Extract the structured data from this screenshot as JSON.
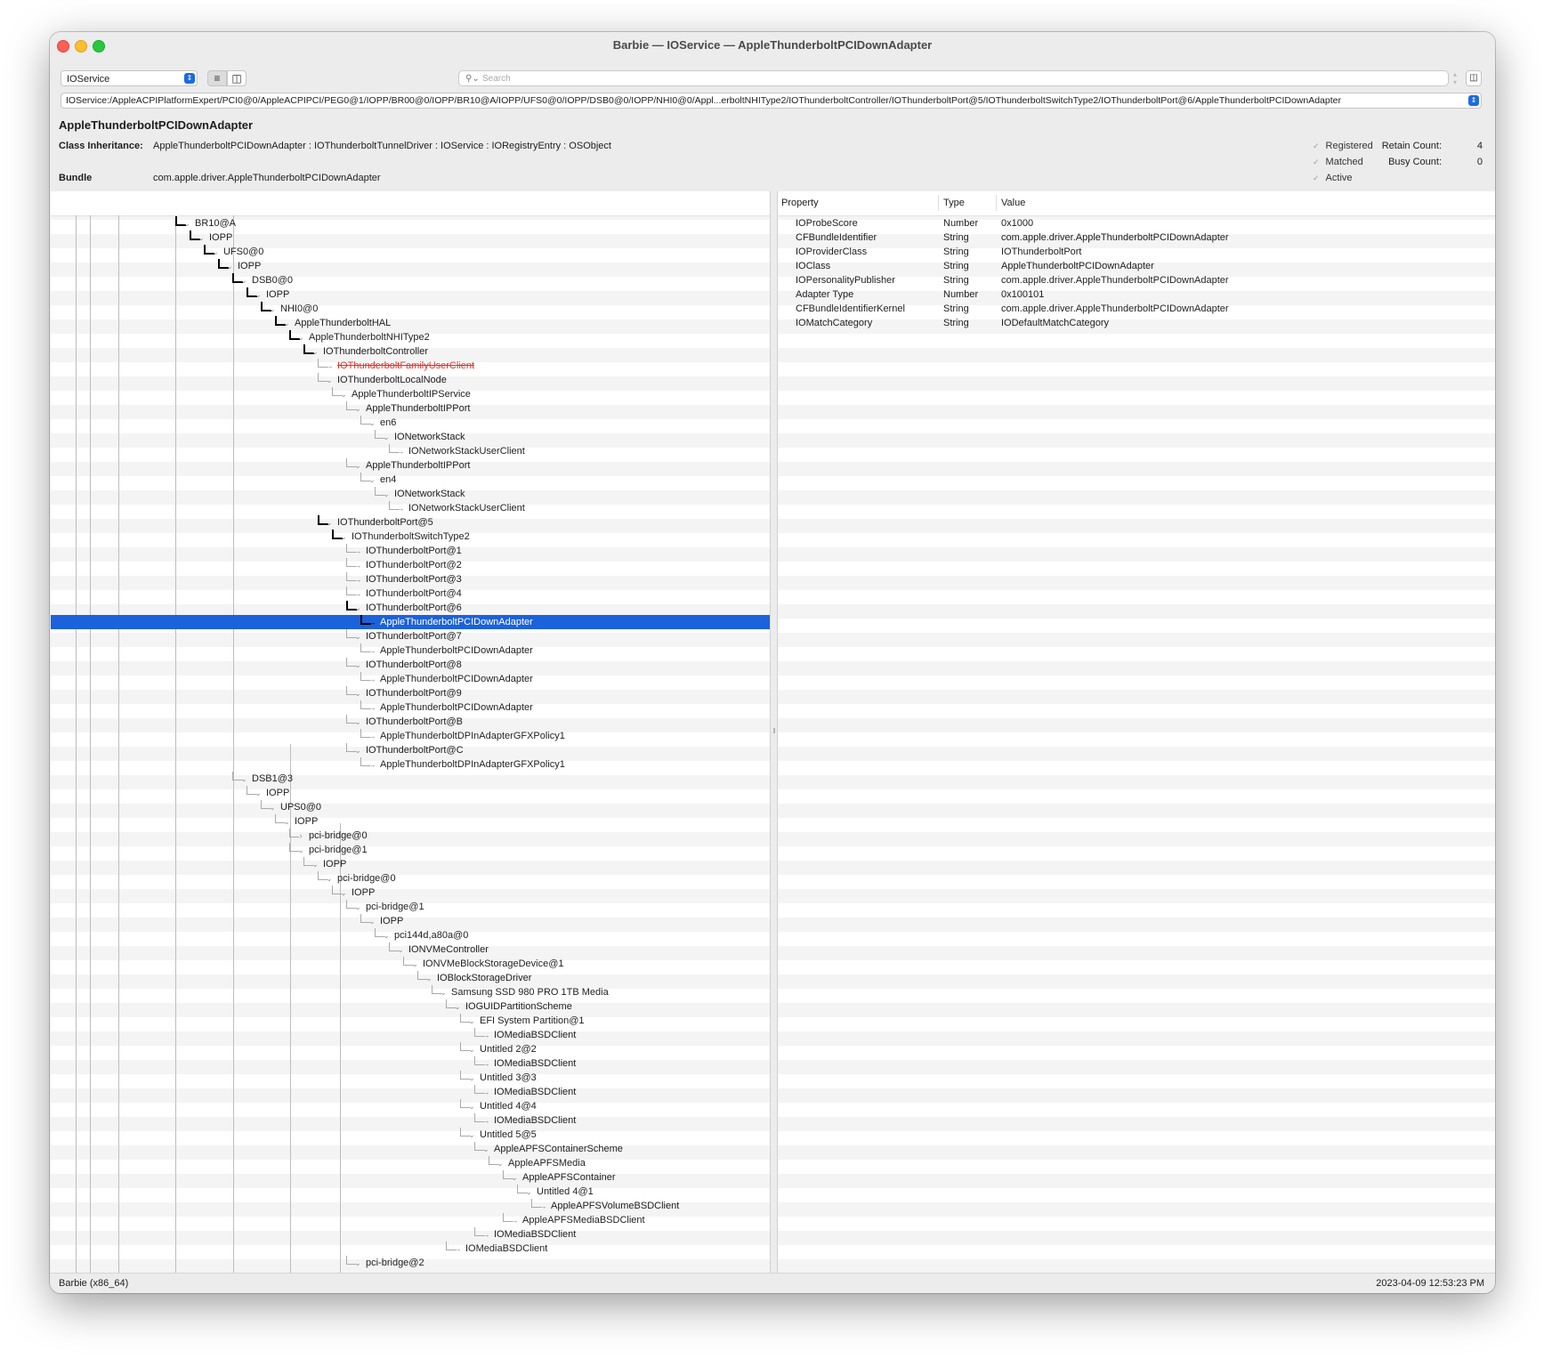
{
  "window": {
    "title": "Barbie — IOService — AppleThunderboltPCIDownAdapter"
  },
  "toolbar": {
    "plane": "IOService",
    "search_placeholder": "Search",
    "path": "IOService:/AppleACPIPlatformExpert/PCI0@0/AppleACPIPCI/PEG0@1/IOPP/BR00@0/IOPP/BR10@A/IOPP/UFS0@0/IOPP/DSB0@0/IOPP/NHI0@0/Appl...erboltNHIType2/IOThunderboltController/IOThunderboltPort@5/IOThunderboltSwitchType2/IOThunderboltPort@6/AppleThunderboltPCIDownAdapter"
  },
  "info": {
    "name": "AppleThunderboltPCIDownAdapter",
    "class_label": "Class Inheritance:",
    "class_value": "AppleThunderboltPCIDownAdapter : IOThunderboltTunnelDriver : IOService : IORegistryEntry : OSObject",
    "bundle_label": "Bundle",
    "bundle_value": "com.apple.driver.AppleThunderboltPCIDownAdapter",
    "flags": [
      "Registered",
      "Matched",
      "Active"
    ],
    "retain_label": "Retain Count:",
    "retain_value": "4",
    "busy_label": "Busy Count:",
    "busy_value": "0"
  },
  "tree": [
    {
      "name": "BR10@A",
      "depth": 0,
      "toggle": "v",
      "dark": true
    },
    {
      "name": "IOPP",
      "depth": 1,
      "toggle": "v",
      "dark": true
    },
    {
      "name": "UFS0@0",
      "depth": 2,
      "toggle": "v",
      "dark": true
    },
    {
      "name": "IOPP",
      "depth": 3,
      "toggle": "v",
      "dark": true
    },
    {
      "name": "DSB0@0",
      "depth": 4,
      "toggle": "v",
      "dark": true
    },
    {
      "name": "IOPP",
      "depth": 5,
      "toggle": "v",
      "dark": true
    },
    {
      "name": "NHI0@0",
      "depth": 6,
      "toggle": "v",
      "dark": true
    },
    {
      "name": "AppleThunderboltHAL",
      "depth": 7,
      "toggle": "v",
      "dark": true
    },
    {
      "name": "AppleThunderboltNHIType2",
      "depth": 8,
      "toggle": "v",
      "dark": true
    },
    {
      "name": "IOThunderboltController",
      "depth": 9,
      "toggle": "v",
      "dark": true
    },
    {
      "name": "IOThunderboltFamilyUserClient",
      "depth": 10,
      "toggle": "-",
      "terminated": true
    },
    {
      "name": "IOThunderboltLocalNode",
      "depth": 10,
      "toggle": "v"
    },
    {
      "name": "AppleThunderboltIPService",
      "depth": 11,
      "toggle": "v"
    },
    {
      "name": "AppleThunderboltIPPort",
      "depth": 12,
      "toggle": "v"
    },
    {
      "name": "en6",
      "depth": 13,
      "toggle": "v"
    },
    {
      "name": "IONetworkStack",
      "depth": 14,
      "toggle": "v"
    },
    {
      "name": "IONetworkStackUserClient",
      "depth": 15,
      "toggle": "-"
    },
    {
      "name": "AppleThunderboltIPPort",
      "depth": 12,
      "toggle": "v"
    },
    {
      "name": "en4",
      "depth": 13,
      "toggle": "v"
    },
    {
      "name": "IONetworkStack",
      "depth": 14,
      "toggle": "v"
    },
    {
      "name": "IONetworkStackUserClient",
      "depth": 15,
      "toggle": "-"
    },
    {
      "name": "IOThunderboltPort@5",
      "depth": 10,
      "toggle": "v",
      "dark": true
    },
    {
      "name": "IOThunderboltSwitchType2",
      "depth": 11,
      "toggle": "v",
      "dark": true
    },
    {
      "name": "IOThunderboltPort@1",
      "depth": 12,
      "toggle": "-"
    },
    {
      "name": "IOThunderboltPort@2",
      "depth": 12,
      "toggle": "-"
    },
    {
      "name": "IOThunderboltPort@3",
      "depth": 12,
      "toggle": "-"
    },
    {
      "name": "IOThunderboltPort@4",
      "depth": 12,
      "toggle": "-"
    },
    {
      "name": "IOThunderboltPort@6",
      "depth": 12,
      "toggle": "v",
      "dark": true
    },
    {
      "name": "AppleThunderboltPCIDownAdapter",
      "depth": 13,
      "toggle": "-",
      "selected": true,
      "dark": true
    },
    {
      "name": "IOThunderboltPort@7",
      "depth": 12,
      "toggle": "v"
    },
    {
      "name": "AppleThunderboltPCIDownAdapter",
      "depth": 13,
      "toggle": "-"
    },
    {
      "name": "IOThunderboltPort@8",
      "depth": 12,
      "toggle": "v"
    },
    {
      "name": "AppleThunderboltPCIDownAdapter",
      "depth": 13,
      "toggle": "-"
    },
    {
      "name": "IOThunderboltPort@9",
      "depth": 12,
      "toggle": "v"
    },
    {
      "name": "AppleThunderboltPCIDownAdapter",
      "depth": 13,
      "toggle": "-"
    },
    {
      "name": "IOThunderboltPort@B",
      "depth": 12,
      "toggle": "v"
    },
    {
      "name": "AppleThunderboltDPInAdapterGFXPolicy1",
      "depth": 13,
      "toggle": "-"
    },
    {
      "name": "IOThunderboltPort@C",
      "depth": 12,
      "toggle": "v"
    },
    {
      "name": "AppleThunderboltDPInAdapterGFXPolicy1",
      "depth": 13,
      "toggle": "-"
    },
    {
      "name": "DSB1@3",
      "depth": 4,
      "toggle": "v"
    },
    {
      "name": "IOPP",
      "depth": 5,
      "toggle": "v"
    },
    {
      "name": "UPS0@0",
      "depth": 6,
      "toggle": "v"
    },
    {
      "name": "IOPP",
      "depth": 7,
      "toggle": "v"
    },
    {
      "name": "pci-bridge@0",
      "depth": 8,
      "toggle": ">"
    },
    {
      "name": "pci-bridge@1",
      "depth": 8,
      "toggle": "v"
    },
    {
      "name": "IOPP",
      "depth": 9,
      "toggle": "v"
    },
    {
      "name": "pci-bridge@0",
      "depth": 10,
      "toggle": "v"
    },
    {
      "name": "IOPP",
      "depth": 11,
      "toggle": "v"
    },
    {
      "name": "pci-bridge@1",
      "depth": 12,
      "toggle": "v"
    },
    {
      "name": "IOPP",
      "depth": 13,
      "toggle": "v"
    },
    {
      "name": "pci144d,a80a@0",
      "depth": 14,
      "toggle": "v"
    },
    {
      "name": "IONVMeController",
      "depth": 15,
      "toggle": "v"
    },
    {
      "name": "IONVMeBlockStorageDevice@1",
      "depth": 16,
      "toggle": "v"
    },
    {
      "name": "IOBlockStorageDriver",
      "depth": 17,
      "toggle": "v"
    },
    {
      "name": "Samsung SSD 980 PRO 1TB Media",
      "depth": 18,
      "toggle": "v"
    },
    {
      "name": "IOGUIDPartitionScheme",
      "depth": 19,
      "toggle": "v"
    },
    {
      "name": "EFI System Partition@1",
      "depth": 20,
      "toggle": "v"
    },
    {
      "name": "IOMediaBSDClient",
      "depth": 21,
      "toggle": "-"
    },
    {
      "name": "Untitled 2@2",
      "depth": 20,
      "toggle": "v"
    },
    {
      "name": "IOMediaBSDClient",
      "depth": 21,
      "toggle": "-"
    },
    {
      "name": "Untitled 3@3",
      "depth": 20,
      "toggle": "v"
    },
    {
      "name": "IOMediaBSDClient",
      "depth": 21,
      "toggle": "-"
    },
    {
      "name": "Untitled 4@4",
      "depth": 20,
      "toggle": "v"
    },
    {
      "name": "IOMediaBSDClient",
      "depth": 21,
      "toggle": "-"
    },
    {
      "name": "Untitled 5@5",
      "depth": 20,
      "toggle": "v"
    },
    {
      "name": "AppleAPFSContainerScheme",
      "depth": 21,
      "toggle": "v"
    },
    {
      "name": "AppleAPFSMedia",
      "depth": 22,
      "toggle": "v"
    },
    {
      "name": "AppleAPFSContainer",
      "depth": 23,
      "toggle": "v"
    },
    {
      "name": "Untitled 4@1",
      "depth": 24,
      "toggle": "v"
    },
    {
      "name": "AppleAPFSVolumeBSDClient",
      "depth": 25,
      "toggle": "-"
    },
    {
      "name": "AppleAPFSMediaBSDClient",
      "depth": 23,
      "toggle": "-"
    },
    {
      "name": "IOMediaBSDClient",
      "depth": 21,
      "toggle": "-"
    },
    {
      "name": "IOMediaBSDClient",
      "depth": 19,
      "toggle": "-"
    },
    {
      "name": "pci-bridge@2",
      "depth": 12,
      "toggle": "v"
    }
  ],
  "properties": {
    "headers": [
      "Property",
      "Type",
      "Value"
    ],
    "rows": [
      {
        "property": "IOProbeScore",
        "type": "Number",
        "value": "0x1000"
      },
      {
        "property": "CFBundleIdentifier",
        "type": "String",
        "value": "com.apple.driver.AppleThunderboltPCIDownAdapter"
      },
      {
        "property": "IOProviderClass",
        "type": "String",
        "value": "IOThunderboltPort"
      },
      {
        "property": "IOClass",
        "type": "String",
        "value": "AppleThunderboltPCIDownAdapter"
      },
      {
        "property": "IOPersonalityPublisher",
        "type": "String",
        "value": "com.apple.driver.AppleThunderboltPCIDownAdapter"
      },
      {
        "property": "Adapter Type",
        "type": "Number",
        "value": "0x100101"
      },
      {
        "property": "CFBundleIdentifierKernel",
        "type": "String",
        "value": "com.apple.driver.AppleThunderboltPCIDownAdapter"
      },
      {
        "property": "IOMatchCategory",
        "type": "String",
        "value": "IODefaultMatchCategory"
      }
    ]
  },
  "status": {
    "left": "Barbie (x86_64)",
    "right": "2023-04-09 12:53:23 PM"
  },
  "colors": {
    "selection": "#1c62da",
    "terminated": "#e0302a",
    "close": "#ff5f57",
    "minimize": "#febc2e",
    "zoom": "#28c840"
  }
}
